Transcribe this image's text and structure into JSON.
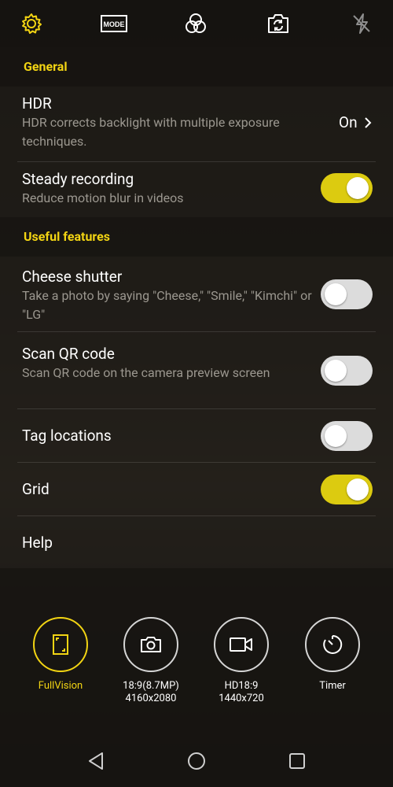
{
  "topbar": {
    "icons": [
      "gear-icon",
      "mode-icon",
      "filter-icon",
      "switch-camera-icon",
      "flash-off-icon"
    ],
    "mode_label": "MODE"
  },
  "sections": {
    "general": "General",
    "useful": "Useful features"
  },
  "settings": {
    "hdr": {
      "title": "HDR",
      "desc": "HDR corrects backlight with multiple exposure techniques.",
      "value": "On"
    },
    "steady": {
      "title": "Steady recording",
      "desc": "Reduce motion blur in videos",
      "state": "on"
    },
    "cheese": {
      "title": "Cheese shutter",
      "desc": "Take a photo by saying \"Cheese,\" \"Smile,\" \"Kimchi\" or \"LG\"",
      "state": "off"
    },
    "qr": {
      "title": "Scan QR code",
      "desc": "Scan QR code on the camera preview screen",
      "state": "off"
    },
    "tag": {
      "title": "Tag locations",
      "state": "off"
    },
    "grid": {
      "title": "Grid",
      "state": "on"
    },
    "help": {
      "title": "Help"
    }
  },
  "quick": [
    {
      "icon": "fullvision-icon",
      "line1": "FullVision",
      "line2": "",
      "active": true
    },
    {
      "icon": "camera-icon",
      "line1": "18:9(8.7MP)",
      "line2": "4160x2080",
      "active": false
    },
    {
      "icon": "video-icon",
      "line1": "HD18:9",
      "line2": "1440x720",
      "active": false
    },
    {
      "icon": "timer-icon",
      "line1": "Timer",
      "line2": "",
      "active": false
    }
  ],
  "nav": [
    "back-icon",
    "home-icon",
    "recents-icon"
  ],
  "colors": {
    "accent": "#f2d413",
    "toggle_on": "#dccb10",
    "toggle_off": "#dcdcdc"
  }
}
